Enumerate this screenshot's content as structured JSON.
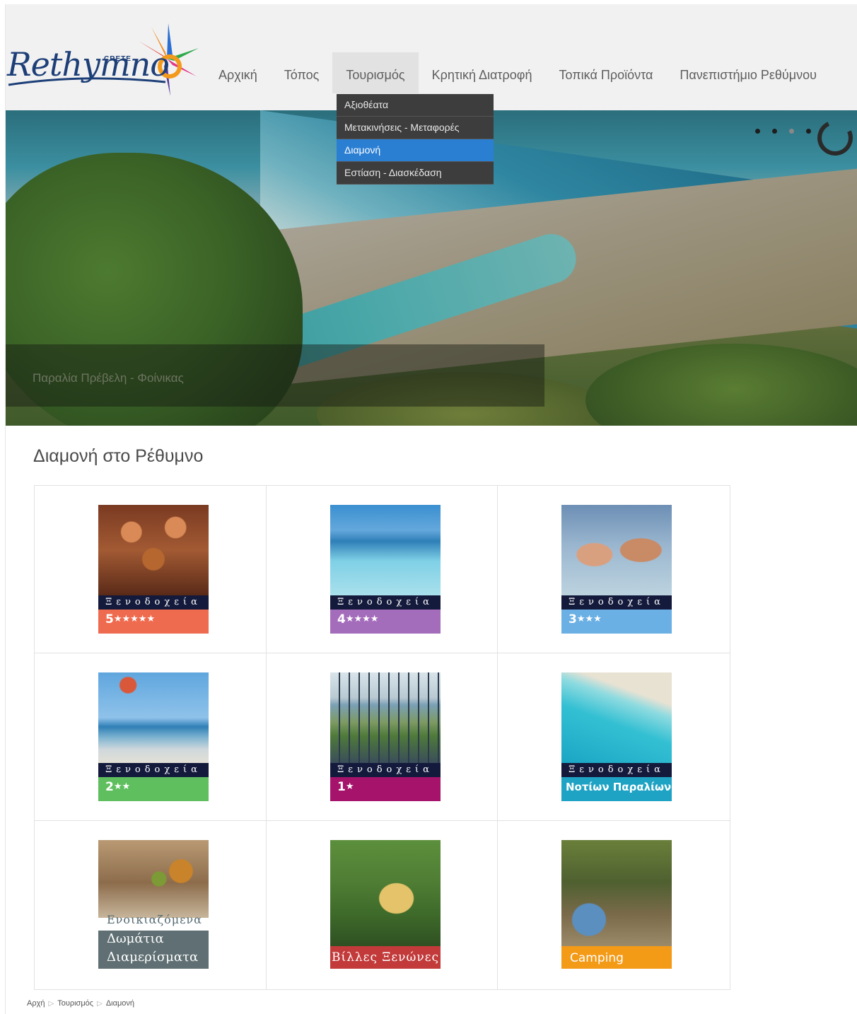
{
  "brand": {
    "logo_text": "Rethymno",
    "logo_small": "CRETE"
  },
  "nav": {
    "items": [
      {
        "label": "Αρχική"
      },
      {
        "label": "Τόπος"
      },
      {
        "label": "Τουρισμός"
      },
      {
        "label": "Κρητική Διατροφή"
      },
      {
        "label": "Τοπικά Προϊόντα"
      },
      {
        "label": "Πανεπιστήμιο Ρεθύμνου"
      }
    ],
    "active": "Τουρισμός",
    "dropdown": [
      {
        "label": "Αξιοθέατα"
      },
      {
        "label": "Μετακινήσεις - Μεταφορές"
      },
      {
        "label": "Διαμονή"
      },
      {
        "label": "Εστίαση - Διασκέδαση"
      }
    ],
    "dropdown_selected": "Διαμονή"
  },
  "hero": {
    "caption": "Παραλία Πρέβελη - Φοίνικας",
    "slide_count": 4,
    "current_slide": 3
  },
  "main": {
    "title": "Διαμονή στο Ρέθυμνο",
    "cards": [
      {
        "band": "Ξενοδοχεία",
        "label_num": "5",
        "label_stars": "★★★★★",
        "color": "#ef6b4f"
      },
      {
        "band": "Ξενοδοχεία",
        "label_num": "4",
        "label_stars": "★★★★",
        "color": "#a46dbb"
      },
      {
        "band": "Ξενοδοχεία",
        "label_num": "3",
        "label_stars": "★★★",
        "color": "#6ab0e4"
      },
      {
        "band": "Ξενοδοχεία",
        "label_num": "2",
        "label_stars": "★★",
        "color": "#5fbf5f"
      },
      {
        "band": "Ξενοδοχεία",
        "label_num": "1",
        "label_stars": "★",
        "color": "#a5136a"
      },
      {
        "band": "Ξενοδοχεία",
        "label_text": "Νοτίων Παραλίων",
        "color": "#1fa3c4"
      },
      {
        "label_line1": "Ενοικιαζόμενα",
        "label_line2": "Δωμάτια",
        "label_line3": "Διαμερίσματα",
        "color": "#5f6f73"
      },
      {
        "label_text": "Βίλλες Ξενώνες",
        "color": "#c23a3a"
      },
      {
        "label_text": "Camping",
        "color": "#f39a17"
      }
    ]
  },
  "breadcrumb": {
    "items": [
      "Αρχή",
      "Τουρισμός",
      "Διαμονή"
    ],
    "separator": "▷"
  }
}
